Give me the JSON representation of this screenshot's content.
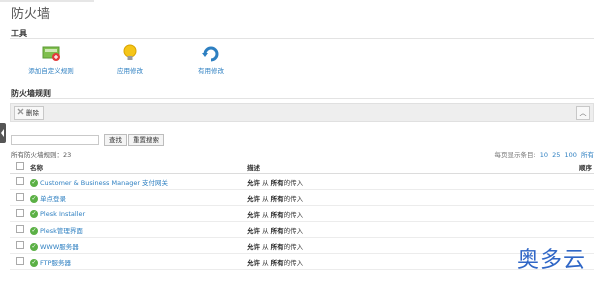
{
  "page": {
    "title": "防火墙"
  },
  "tools": {
    "heading": "工具",
    "items": [
      {
        "label": "添加自定义规则",
        "icon": "add-rule-icon"
      },
      {
        "label": "应用修改",
        "icon": "apply-lightbulb-icon"
      },
      {
        "label": "有用修改",
        "icon": "refresh-icon"
      }
    ]
  },
  "rules": {
    "heading": "防火墙规则",
    "delete_label": "删除",
    "collapse_icon": "chevron-up-icon",
    "search": {
      "value": "",
      "placeholder": ""
    },
    "search_button": "查找",
    "reset_button": "重置搜索",
    "count_text": "所有防火墙规则：23",
    "per_page_label": "每页显示条目:",
    "per_page_options": [
      "10",
      "25",
      "100",
      "所有"
    ],
    "columns": {
      "name": "名称",
      "desc": "描述",
      "order": "顺序"
    },
    "rows": [
      {
        "name": "Customer & Business Manager 支付网关",
        "desc_a": "允许",
        "desc_b": " 从 ",
        "desc_c": "所有",
        "desc_d": "的传入"
      },
      {
        "name": "单点登录",
        "desc_a": "允许",
        "desc_b": " 从 ",
        "desc_c": "所有",
        "desc_d": "的传入"
      },
      {
        "name": "Plesk Installer",
        "desc_a": "允许",
        "desc_b": " 从 ",
        "desc_c": "所有",
        "desc_d": "的传入"
      },
      {
        "name": "Plesk管理界面",
        "desc_a": "允许",
        "desc_b": " 从 ",
        "desc_c": "所有",
        "desc_d": "的传入"
      },
      {
        "name": "WWW服务器",
        "desc_a": "允许",
        "desc_b": " 从 ",
        "desc_c": "所有",
        "desc_d": "的传入"
      },
      {
        "name": "FTP服务器",
        "desc_a": "允许",
        "desc_b": " 从 ",
        "desc_c": "所有",
        "desc_d": "的传入"
      }
    ]
  },
  "watermark": "奥多云",
  "colors": {
    "link": "#2d7fc1",
    "ok": "#5bb045",
    "watermark": "#2f66c6"
  }
}
